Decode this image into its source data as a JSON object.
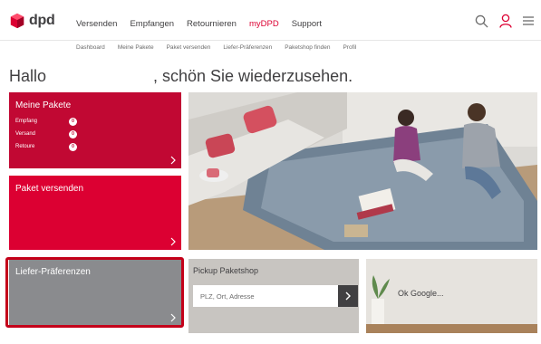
{
  "brand": {
    "name": "dpd",
    "color": "#dc0032"
  },
  "nav": {
    "items": [
      "Versenden",
      "Empfangen",
      "Retournieren",
      "myDPD",
      "Support"
    ],
    "active": "myDPD"
  },
  "subnav": [
    "Dashboard",
    "Meine Pakete",
    "Paket versenden",
    "Liefer-Präferenzen",
    "Paketshop finden",
    "Profil"
  ],
  "greeting": {
    "hello": "Hallo",
    "rest": ", schön Sie wiederzusehen."
  },
  "tiles": {
    "meine_pakete": {
      "title": "Meine Pakete",
      "rows": [
        {
          "label": "Empfang",
          "count": "0"
        },
        {
          "label": "Versand",
          "count": "0"
        },
        {
          "label": "Retoure",
          "count": "0"
        }
      ]
    },
    "paket_versenden": {
      "title": "Paket versenden"
    },
    "liefer_praeferenzen": {
      "title": "Liefer-Präferenzen"
    },
    "pickup": {
      "title": "Pickup Paketshop",
      "placeholder": "PLZ, Ort, Adresse"
    },
    "google": {
      "text": "Ok Google..."
    }
  },
  "icons": [
    "search-icon",
    "user-icon",
    "menu-icon",
    "chevron-right-icon"
  ]
}
